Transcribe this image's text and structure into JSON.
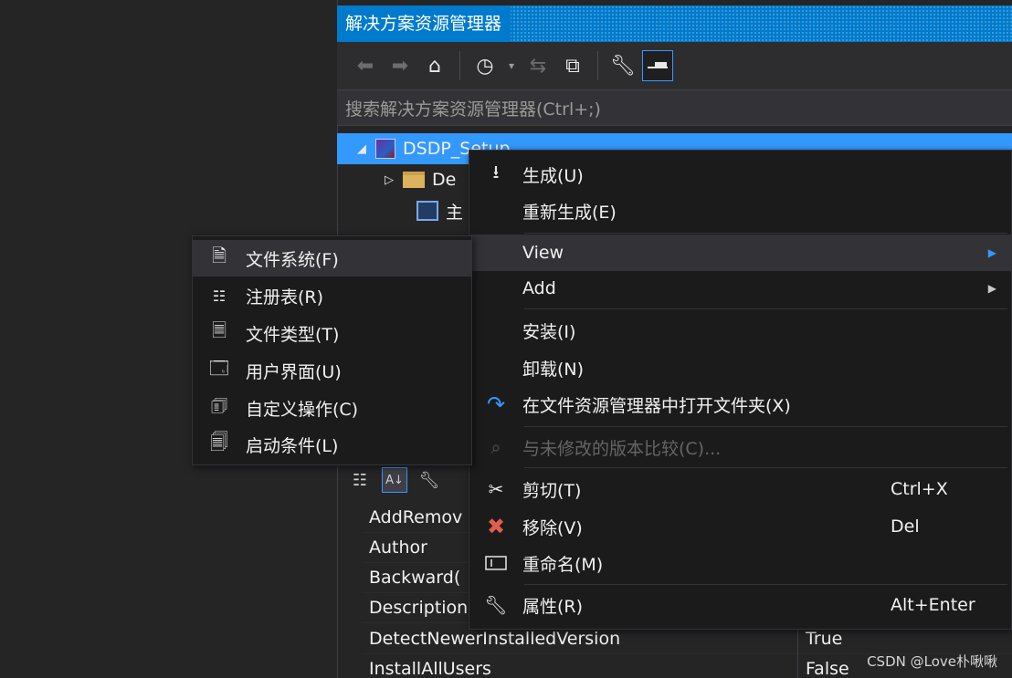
{
  "solution_explorer": {
    "title": "解决方案资源管理器",
    "search_placeholder": "搜索解决方案资源管理器(Ctrl+;)",
    "toolbar_icons": [
      "back-icon",
      "forward-icon",
      "home-icon",
      "history-icon",
      "dropdown-icon",
      "sync-icon",
      "collapse-icon",
      "wrench-icon",
      "pin-icon"
    ],
    "tree": {
      "project": "DSDP_Setup",
      "child_folder": "De",
      "child_main": "主"
    }
  },
  "properties": {
    "rows": [
      {
        "name": "AddRemov",
        "value": ""
      },
      {
        "name": "Author",
        "value": ""
      },
      {
        "name": "Backward(",
        "value": ""
      },
      {
        "name": "Description",
        "value": ""
      },
      {
        "name": "DetectNewerInstalledVersion",
        "value": "True"
      },
      {
        "name": "InstallAllUsers",
        "value": "False"
      }
    ]
  },
  "context_menu": {
    "items": [
      {
        "label": "生成(U)",
        "icon": "build-icon"
      },
      {
        "label": "重新生成(E)",
        "icon": ""
      },
      {
        "label": "View",
        "icon": "",
        "submenu": true
      },
      {
        "label": "Add",
        "icon": "",
        "submenu": true
      },
      {
        "label": "安装(I)",
        "icon": ""
      },
      {
        "label": "卸载(N)",
        "icon": ""
      },
      {
        "label": "在文件资源管理器中打开文件夹(X)",
        "icon": "open-folder-arrow-icon"
      },
      {
        "label": "与未修改的版本比较(C)...",
        "icon": "compare-icon",
        "disabled": true
      },
      {
        "label": "剪切(T)",
        "icon": "scissors-icon",
        "shortcut": "Ctrl+X"
      },
      {
        "label": "移除(V)",
        "icon": "remove-x-icon",
        "shortcut": "Del"
      },
      {
        "label": "重命名(M)",
        "icon": "rename-icon"
      },
      {
        "label": "属性(R)",
        "icon": "wrench-icon",
        "shortcut": "Alt+Enter"
      }
    ]
  },
  "submenu": {
    "items": [
      {
        "label": "文件系统(F)",
        "icon": "file-system-icon"
      },
      {
        "label": "注册表(R)",
        "icon": "registry-icon"
      },
      {
        "label": "文件类型(T)",
        "icon": "file-types-icon"
      },
      {
        "label": "用户界面(U)",
        "icon": "user-interface-icon"
      },
      {
        "label": "自定义操作(C)",
        "icon": "custom-actions-icon"
      },
      {
        "label": "启动条件(L)",
        "icon": "launch-conditions-icon"
      }
    ]
  },
  "watermark": "CSDN @Love朴啾啾",
  "colors": {
    "accent": "#007acc",
    "selection": "#3399ff",
    "menu_bg": "#1b1b1c",
    "panel_bg": "#252526"
  }
}
